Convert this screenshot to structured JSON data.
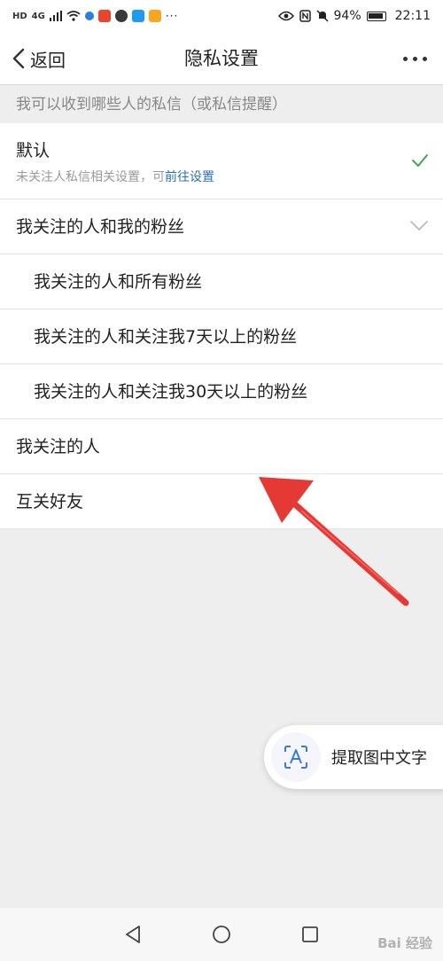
{
  "status_bar": {
    "network": "4G",
    "battery": "94%",
    "time": "22:11",
    "icon_colors": [
      "#e8452c",
      "#f08a1c",
      "#2a7de1",
      "#1b9cf0",
      "#f5a623"
    ]
  },
  "nav": {
    "back_label": "返回",
    "title": "隐私设置"
  },
  "section": {
    "header": "我可以收到哪些人的私信（或私信提醒）"
  },
  "options": {
    "default": {
      "label": "默认",
      "desc_prefix": "未关注人私信相关设置，可",
      "desc_link": "前往设置"
    },
    "follow_and_fans": {
      "label": "我关注的人和我的粉丝"
    },
    "follow_and_all_fans": {
      "label": "我关注的人和所有粉丝"
    },
    "follow_and_fans_7": {
      "label": "我关注的人和关注我7天以上的粉丝"
    },
    "follow_and_fans_30": {
      "label": "我关注的人和关注我30天以上的粉丝"
    },
    "following": {
      "label": "我关注的人"
    },
    "mutual": {
      "label": "互关好友"
    }
  },
  "ocr_button": {
    "label": "提取图中文字"
  },
  "watermark": "Bai 经验",
  "colors": {
    "accent_check": "#3aa757",
    "link": "#2a6fb8",
    "annotation_arrow": "#e53935"
  }
}
